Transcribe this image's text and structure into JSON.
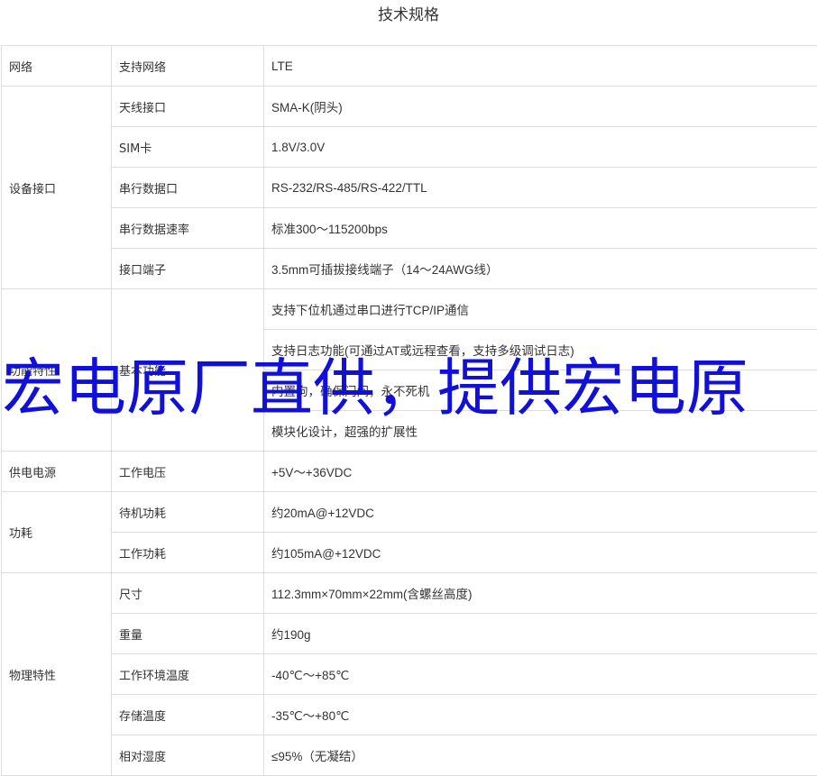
{
  "title": "技术规格",
  "table": {
    "groups": [
      {
        "category": "网络",
        "rows": [
          {
            "name": "支持网络",
            "value": "LTE"
          }
        ]
      },
      {
        "category": "设备接口",
        "rows": [
          {
            "name": "天线接口",
            "value": "SMA-K(阴头)"
          },
          {
            "name": "SIM卡",
            "value": "1.8V/3.0V"
          },
          {
            "name": "串行数据口",
            "value": "RS-232/RS-485/RS-422/TTL"
          },
          {
            "name": "串行数据速率",
            "value": "标准300～115200bps"
          },
          {
            "name": "接口端子",
            "value": "3.5mm可插拔接线端子（14～24AWG线）"
          }
        ]
      },
      {
        "category": "功能特性",
        "rows": [
          {
            "name": "基本功能",
            "values": [
              "支持下位机通过串口进行TCP/IP通信",
              "支持日志功能(可通过AT或远程查看，支持多级调试日志)",
              "内置狗，确保门间，永不死机",
              "模块化设计，超强的扩展性"
            ]
          }
        ]
      },
      {
        "category": "供电电源",
        "rows": [
          {
            "name": "工作电压",
            "value": "+5V～+36VDC"
          }
        ]
      },
      {
        "category": "功耗",
        "rows": [
          {
            "name": "待机功耗",
            "value": "约20mA@+12VDC"
          },
          {
            "name": "工作功耗",
            "value": "约105mA@+12VDC"
          }
        ]
      },
      {
        "category": "物理特性",
        "rows": [
          {
            "name": "尺寸",
            "value": "112.3mm×70mm×22mm(含螺丝高度)"
          },
          {
            "name": "重量",
            "value": "约190g"
          },
          {
            "name": "工作环境温度",
            "value": "-40℃～+85℃"
          },
          {
            "name": "存储温度",
            "value": "-35℃～+80℃"
          },
          {
            "name": "相对湿度",
            "value": "≤95%（无凝结）"
          }
        ]
      }
    ]
  },
  "watermark": "宏电原厂直供，提供宏电原",
  "colors": {
    "border": "#dddddd",
    "text": "#333333",
    "watermark": "#1010d8"
  }
}
